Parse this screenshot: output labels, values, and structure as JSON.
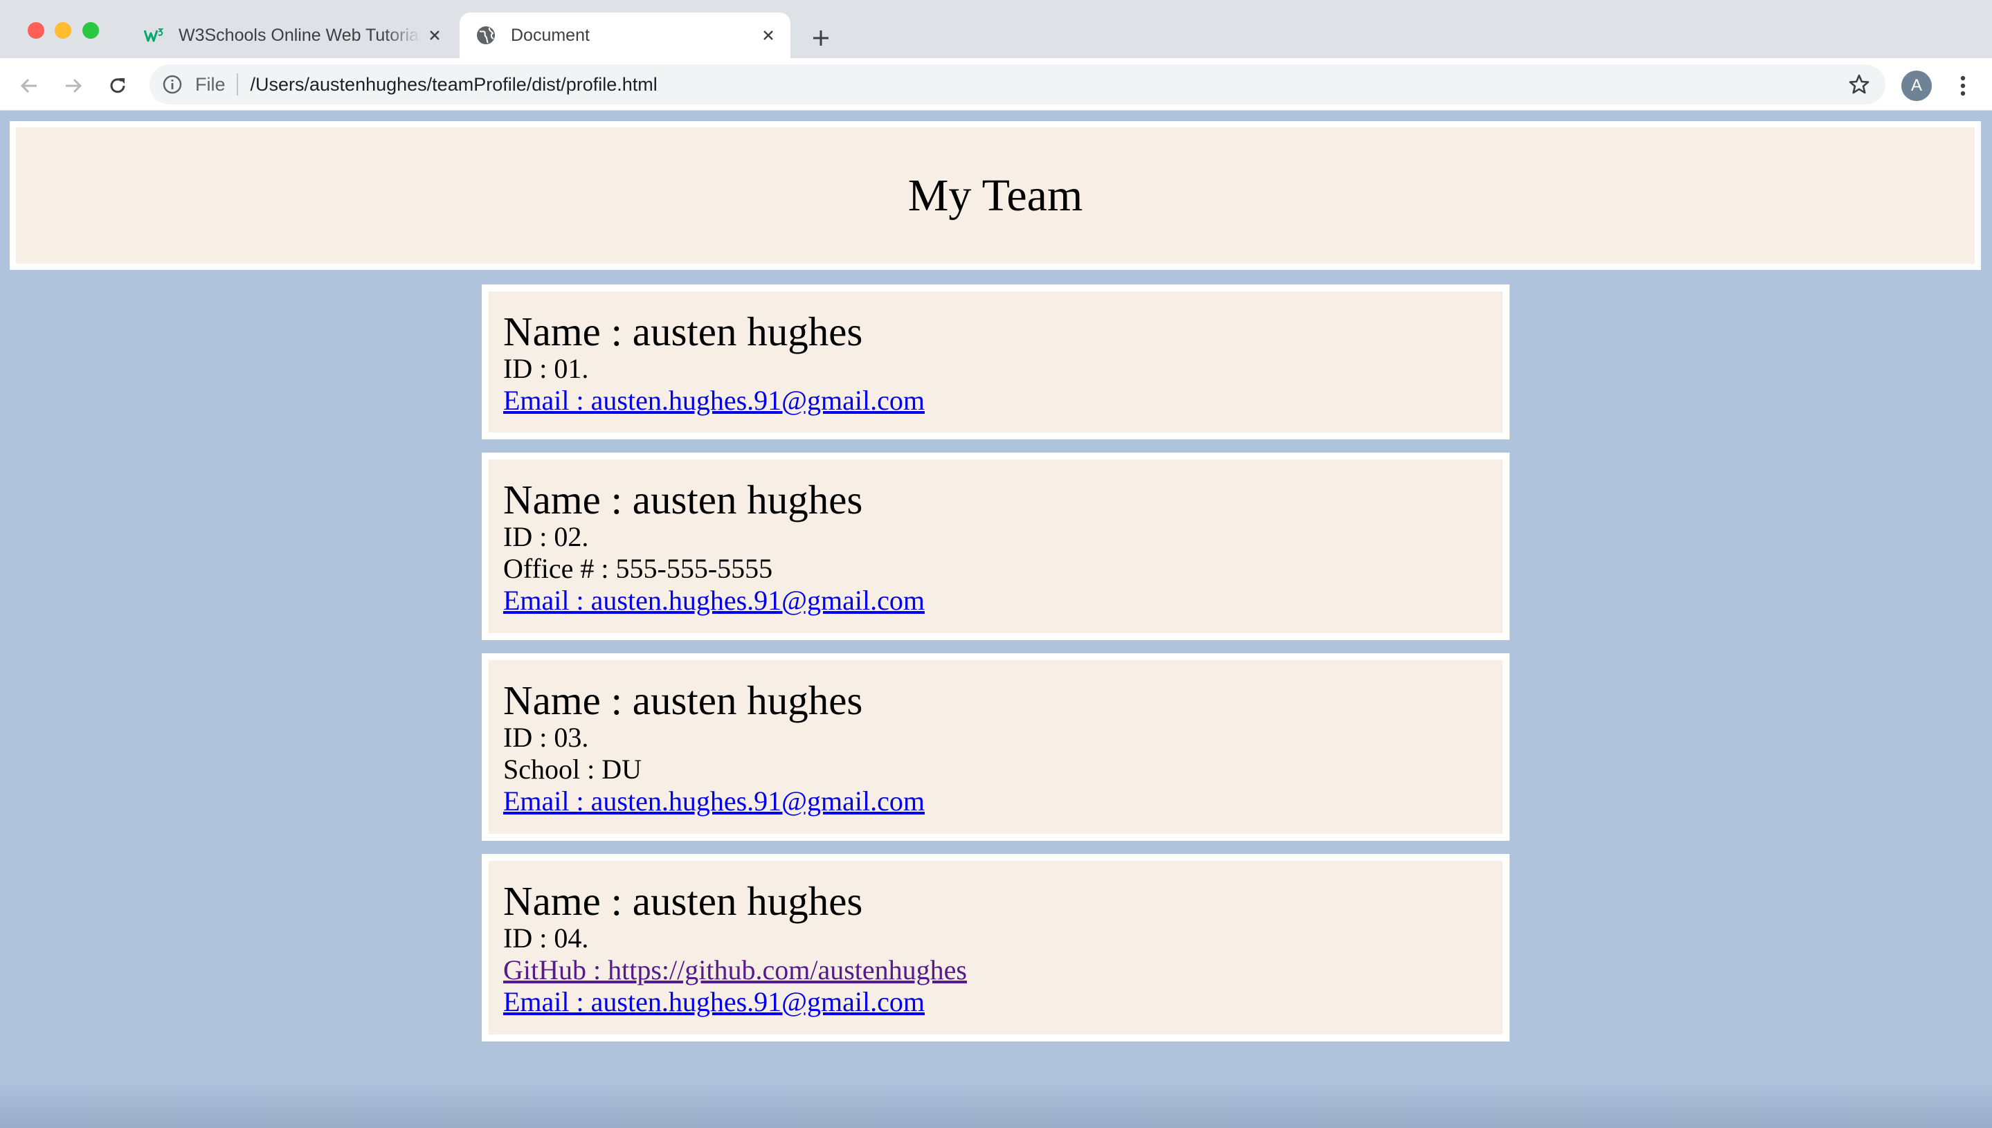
{
  "browser": {
    "tabs": [
      {
        "title": "W3Schools Online Web Tutorials",
        "favicon": "w3schools-icon",
        "active": false
      },
      {
        "title": "Document",
        "favicon": "globe-icon",
        "active": true
      }
    ],
    "address_bar": {
      "scheme": "File",
      "url": "/Users/austenhughes/teamProfile/dist/profile.html"
    },
    "profile_initial": "A"
  },
  "page": {
    "header_title": "My Team",
    "cards": [
      {
        "name": "Name : austen hughes",
        "id": "ID : 01.",
        "email": "Email : austen.hughes.91@gmail.com"
      },
      {
        "name": "Name : austen hughes",
        "id": "ID : 02.",
        "office": "Office # : 555-555-5555",
        "email": "Email : austen.hughes.91@gmail.com"
      },
      {
        "name": "Name : austen hughes",
        "id": "ID : 03.",
        "school": "School : DU",
        "email": "Email : austen.hughes.91@gmail.com"
      },
      {
        "name": "Name : austen hughes",
        "id": "ID : 04.",
        "github": "GitHub : https://github.com/austenhughes",
        "email": "Email : austen.hughes.91@gmail.com"
      }
    ]
  },
  "colors": {
    "page_background": "#b0c3dd",
    "card_background": "#f7efe5",
    "card_border": "#ffffff",
    "link": "#0000ee",
    "visited_link": "#551a8b"
  }
}
